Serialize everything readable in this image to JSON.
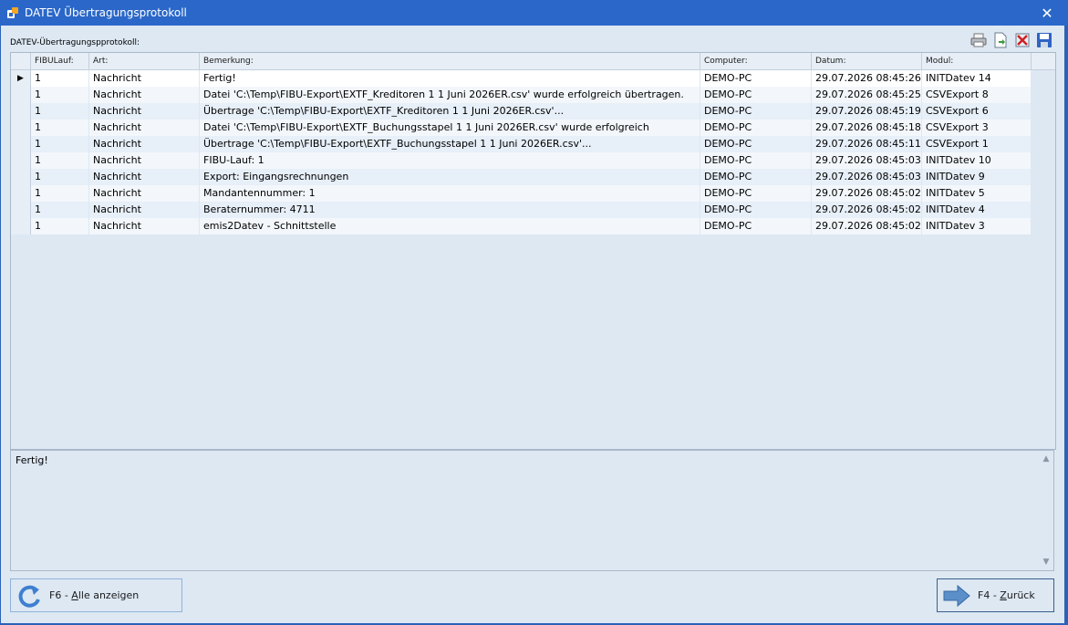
{
  "window": {
    "title": "DATEV Übertragungsprotokoll",
    "close_glyph": "✕"
  },
  "grid_label": "DATEV-Übertragungspprotokoll:",
  "toolbar": {
    "icons": [
      "printer-icon",
      "export-icon",
      "delete-icon",
      "save-icon"
    ]
  },
  "columns": [
    "FIBULauf:",
    "Art:",
    "Bemerkung:",
    "Computer:",
    "Datum:",
    "Modul:"
  ],
  "rows": [
    [
      "1",
      "Nachricht",
      "Fertig!",
      "DEMO-PC",
      "29.07.2026 08:45:26",
      "INITDatev 14"
    ],
    [
      "1",
      "Nachricht",
      "Datei 'C:\\Temp\\FIBU-Export\\EXTF_Kreditoren 1 1 Juni 2026ER.csv' wurde erfolgreich übertragen.",
      "DEMO-PC",
      "29.07.2026 08:45:25",
      "CSVExport 8"
    ],
    [
      "1",
      "Nachricht",
      "Übertrage 'C:\\Temp\\FIBU-Export\\EXTF_Kreditoren 1 1 Juni 2026ER.csv'...",
      "DEMO-PC",
      "29.07.2026 08:45:19",
      "CSVExport 6"
    ],
    [
      "1",
      "Nachricht",
      "Datei 'C:\\Temp\\FIBU-Export\\EXTF_Buchungsstapel 1 1 Juni 2026ER.csv' wurde erfolgreich",
      "DEMO-PC",
      "29.07.2026 08:45:18",
      "CSVExport 3"
    ],
    [
      "1",
      "Nachricht",
      "Übertrage 'C:\\Temp\\FIBU-Export\\EXTF_Buchungsstapel 1 1 Juni 2026ER.csv'...",
      "DEMO-PC",
      "29.07.2026 08:45:11",
      "CSVExport 1"
    ],
    [
      "1",
      "Nachricht",
      "FIBU-Lauf: 1",
      "DEMO-PC",
      "29.07.2026 08:45:03",
      "INITDatev 10"
    ],
    [
      "1",
      "Nachricht",
      "Export: Eingangsrechnungen",
      "DEMO-PC",
      "29.07.2026 08:45:03",
      "INITDatev 9"
    ],
    [
      "1",
      "Nachricht",
      "Mandantennummer: 1",
      "DEMO-PC",
      "29.07.2026 08:45:02",
      "INITDatev 5"
    ],
    [
      "1",
      "Nachricht",
      "Beraternummer: 4711",
      "DEMO-PC",
      "29.07.2026 08:45:02",
      "INITDatev 4"
    ],
    [
      "1",
      "Nachricht",
      "emis2Datev - Schnittstelle",
      "DEMO-PC",
      "29.07.2026 08:45:02",
      "INITDatev 3"
    ]
  ],
  "memo": {
    "text": "Fertig!",
    "scroll_up": "▲",
    "scroll_down": "▼"
  },
  "buttons": {
    "all": {
      "key": "F6 - ",
      "mnemonic": "A",
      "rest": "lle anzeigen"
    },
    "back": {
      "key": "F4 - ",
      "mnemonic": "Z",
      "rest": "urück"
    }
  },
  "colors": {
    "titlebar": "#2a67c9",
    "client": "#dde8f3",
    "selected_row": "#ffffff"
  }
}
